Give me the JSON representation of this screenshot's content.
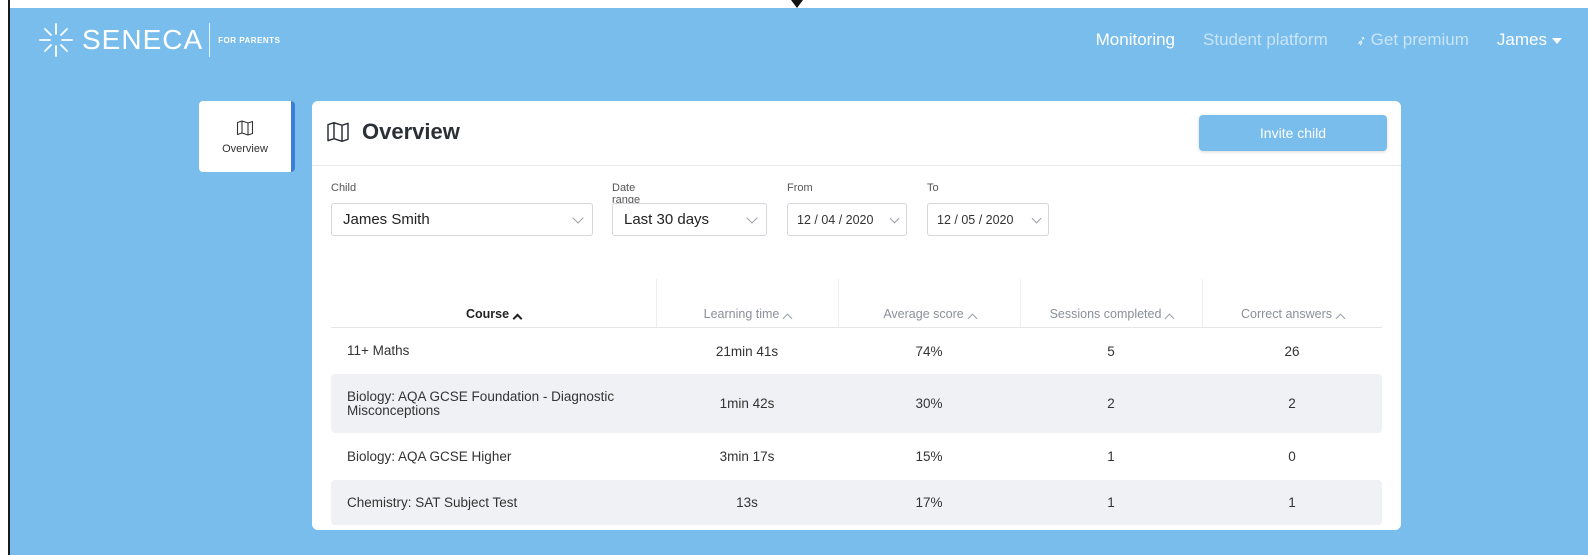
{
  "nav": {
    "brand": "SENECA",
    "brand_sub": "FOR PARENTS",
    "links": {
      "monitoring": "Monitoring",
      "student_platform": "Student platform",
      "get_premium": "Get premium",
      "user": "James"
    }
  },
  "sidebar": {
    "overview_label": "Overview",
    "icon": "map-icon"
  },
  "main": {
    "title": "Overview",
    "invite_label": "Invite child",
    "filters": {
      "child_label": "Child",
      "child_value": "James Smith",
      "range_label": "Date range",
      "range_value": "Last 30 days",
      "from_label": "From",
      "from_value": "12 / 04 / 2020",
      "to_label": "To",
      "to_value": "12 / 05 / 2020"
    },
    "table": {
      "headers": [
        "Course",
        "Learning time",
        "Average score",
        "Sessions completed",
        "Correct answers"
      ],
      "rows": [
        [
          "11+ Maths",
          "21min 41s",
          "74%",
          "5",
          "26"
        ],
        [
          "Biology: AQA GCSE Foundation - Diagnostic Misconceptions",
          "1min 42s",
          "30%",
          "2",
          "2"
        ],
        [
          "Biology: AQA GCSE Higher",
          "3min 17s",
          "15%",
          "1",
          "0"
        ],
        [
          "Chemistry: SAT Subject Test",
          "13s",
          "17%",
          "1",
          "1"
        ]
      ]
    }
  },
  "colors": {
    "background": "#79bdec",
    "accent": "#3c7fd6"
  }
}
